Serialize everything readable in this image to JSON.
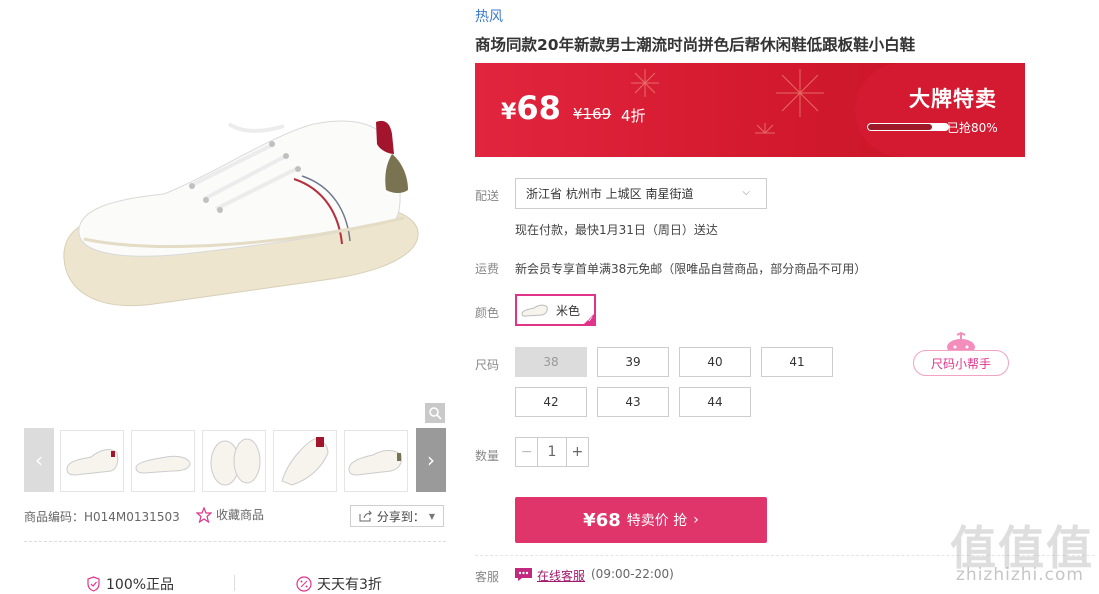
{
  "gallery": {
    "product_code": "商品编码：H014M0131503",
    "favorite_label": "收藏商品",
    "share_label": "分享到：",
    "guarantees": [
      "100%正品",
      "天天有3折"
    ]
  },
  "product": {
    "brand": "热风",
    "title": "商场同款20年新款男士潮流时尚拼色后帮休闲鞋低跟板鞋小白鞋"
  },
  "banner": {
    "price": "¥68",
    "price_symbol": "¥",
    "price_value": "68",
    "original_price": "¥169",
    "discount": "4折",
    "flash_title": "大牌特卖",
    "sold_percent": 0.8,
    "sold_text": "已抢80%"
  },
  "delivery": {
    "label": "配送",
    "address": "浙江省 杭州市 上城区 南星街道",
    "eta": "现在付款，最快1月31日（周日）送达"
  },
  "shipping": {
    "label": "运费",
    "text": "新会员专享首单满38元免邮（限唯品自营商品，部分商品不可用）"
  },
  "color": {
    "label": "颜色",
    "selected": "米色"
  },
  "size": {
    "label": "尺码",
    "options": [
      "38",
      "39",
      "40",
      "41",
      "42",
      "43",
      "44"
    ],
    "disabled": [
      "38"
    ],
    "helper_label": "尺码小帮手"
  },
  "quantity": {
    "label": "数量",
    "minus": "−",
    "value": "1",
    "plus": "+"
  },
  "buy": {
    "price": "¥68",
    "label": "特卖价 抢",
    "arrow": "›"
  },
  "service": {
    "label": "客服",
    "link": "在线客服",
    "hours": "(09:00-22:00)"
  },
  "watermark": {
    "logo": "值值值",
    "url": "zhizhizhi.com"
  },
  "colors": {
    "brand_blue": "#3d7ad1",
    "banner_red": "#d3192d",
    "accent_pink": "#e0348b",
    "buy_button": "#e0356b"
  }
}
